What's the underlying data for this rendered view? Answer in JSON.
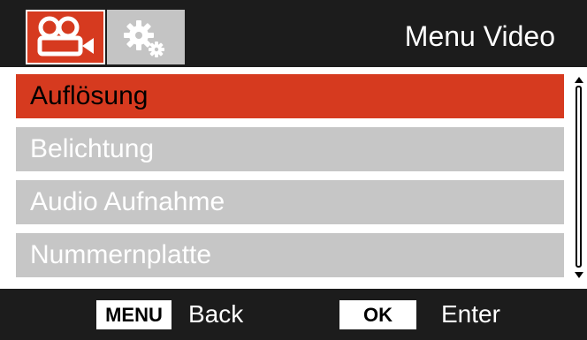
{
  "header": {
    "tabs": [
      {
        "icon": "video-camera-icon",
        "active": true
      },
      {
        "icon": "gears-icon",
        "active": false
      }
    ],
    "title": "Menu Video"
  },
  "menu": {
    "items": [
      {
        "label": "Auflösung",
        "selected": true
      },
      {
        "label": "Belichtung",
        "selected": false
      },
      {
        "label": "Audio Aufnahme",
        "selected": false
      },
      {
        "label": "Nummernplatte",
        "selected": false
      }
    ]
  },
  "footer": {
    "menu_key": "MENU",
    "back_label": "Back",
    "ok_key": "OK",
    "enter_label": "Enter"
  },
  "colors": {
    "accent": "#d63a1f",
    "header_bg": "#1c1c1c",
    "item_bg": "#c6c6c6"
  }
}
